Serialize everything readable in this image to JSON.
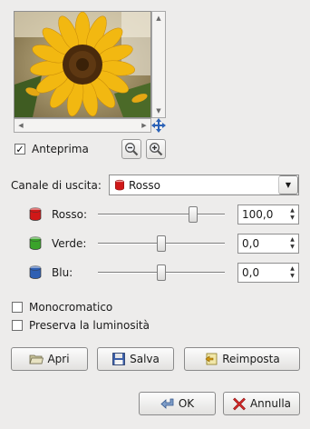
{
  "preview": {
    "checkbox_label": "Anteprima",
    "checked": true
  },
  "output_channel": {
    "label": "Canale di uscita:",
    "value": "Rosso"
  },
  "channels": [
    {
      "name": "red",
      "label": "Rosso:",
      "value": "100,0",
      "color": "#d01818",
      "level": 100
    },
    {
      "name": "green",
      "label": "Verde:",
      "value": "0,0",
      "color": "#3aa32a",
      "level": 0
    },
    {
      "name": "blue",
      "label": "Blu:",
      "value": "0,0",
      "color": "#2e5fb3",
      "level": 0
    }
  ],
  "options": [
    {
      "label": "Monocromatico",
      "checked": false
    },
    {
      "label": "Preserva la luminosità",
      "checked": false
    }
  ],
  "buttons": {
    "open": "Apri",
    "save": "Salva",
    "reset": "Reimposta",
    "ok": "OK",
    "cancel": "Annulla"
  },
  "icons": {
    "preview_image": "sunflower-photo",
    "navigate": "navigate-icon",
    "zoom_out": "zoom-out-icon",
    "zoom_in": "zoom-in-icon",
    "open": "folder-icon",
    "save": "floppy-icon",
    "reset": "reset-icon",
    "ok": "ok-arrow-icon",
    "cancel": "cancel-x-icon"
  }
}
